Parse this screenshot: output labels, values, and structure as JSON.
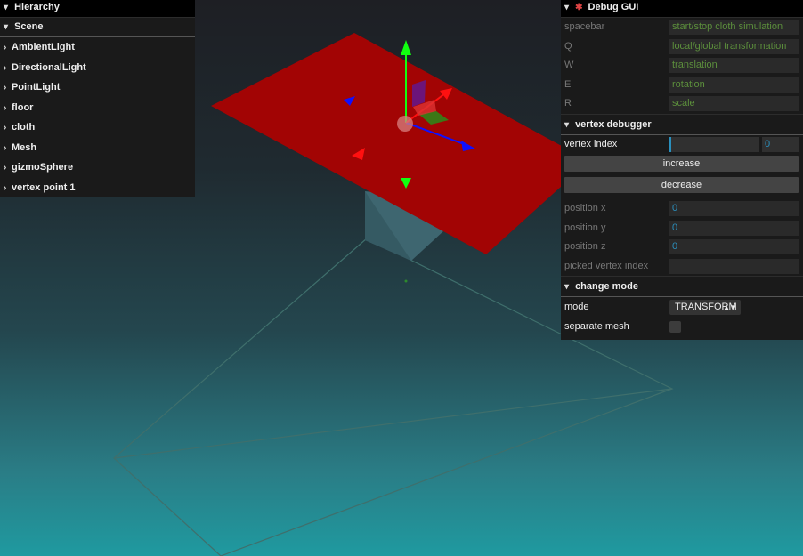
{
  "hierarchy": {
    "title": "Hierarchy",
    "scene_label": "Scene",
    "items": [
      "AmbientLight",
      "DirectionalLight",
      "PointLight",
      "floor",
      "cloth",
      "Mesh",
      "gizmoSphere",
      "vertex point 1"
    ]
  },
  "debug_gui": {
    "title": "Debug GUI",
    "keys": [
      {
        "key": "spacebar",
        "value": "start/stop cloth simulation"
      },
      {
        "key": "Q",
        "value": "local/global transformation"
      },
      {
        "key": "W",
        "value": "translation"
      },
      {
        "key": "E",
        "value": "rotation"
      },
      {
        "key": "R",
        "value": "scale"
      }
    ],
    "vertex_debugger": {
      "title": "vertex debugger",
      "vertex_index_label": "vertex index",
      "vertex_index_value": "0",
      "increase_label": "increase",
      "decrease_label": "decrease",
      "position_x_label": "position x",
      "position_x_value": "0",
      "position_y_label": "position y",
      "position_y_value": "0",
      "position_z_label": "position z",
      "position_z_value": "0",
      "picked_label": "picked vertex index",
      "picked_value": ""
    },
    "change_mode": {
      "title": "change mode",
      "mode_label": "mode",
      "mode_value": "TRANSFORM",
      "separate_mesh_label": "separate mesh"
    }
  },
  "colors": {
    "cloth": "#a20404",
    "mesh": "#3e6670",
    "gizmo_x": "#ff1010",
    "gizmo_y": "#10ff10",
    "gizmo_z": "#1010ff"
  }
}
